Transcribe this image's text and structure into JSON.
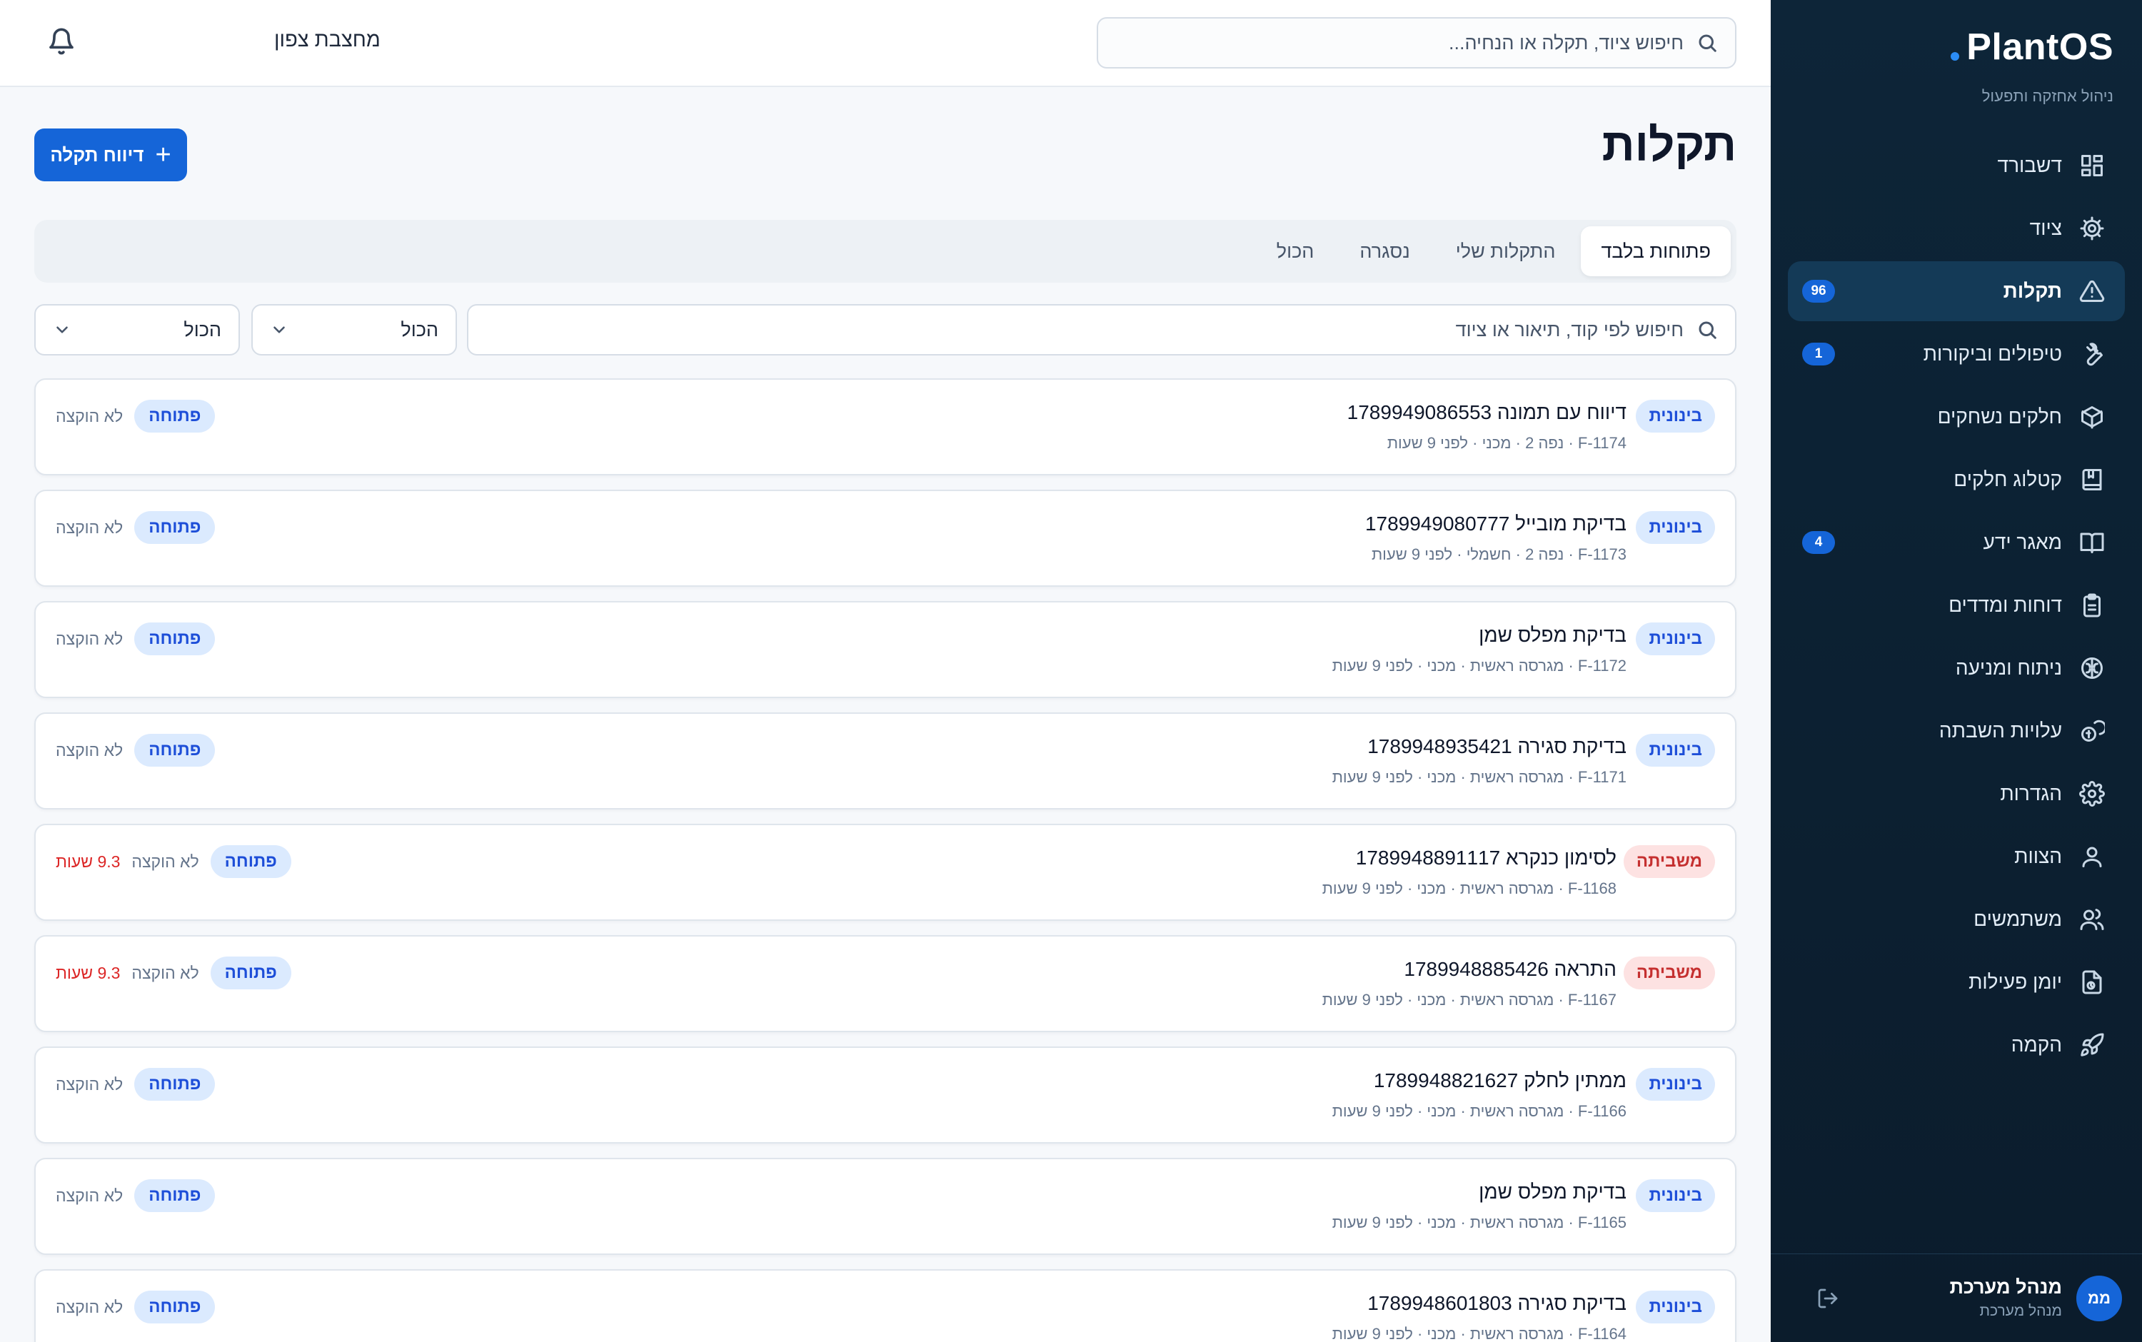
{
  "brand": {
    "title": "PlantOS",
    "subtitle": "ניהול אחזקה ותפעול"
  },
  "nav": [
    {
      "label": "דשבורד",
      "icon": "dashboard-icon",
      "badge": ""
    },
    {
      "label": "ציוד",
      "icon": "gear-icon",
      "badge": ""
    },
    {
      "label": "תקלות",
      "icon": "warning-icon",
      "badge": "96"
    },
    {
      "label": "טיפולים וביקורות",
      "icon": "wrench-icon",
      "badge": "1"
    },
    {
      "label": "חלקים נשחקים",
      "icon": "box-icon",
      "badge": ""
    },
    {
      "label": "קטלוג חלקים",
      "icon": "catalog-icon",
      "badge": ""
    },
    {
      "label": "מאגר ידע",
      "icon": "book-icon",
      "badge": "4"
    },
    {
      "label": "דוחות ומדדים",
      "icon": "clipboard-icon",
      "badge": ""
    },
    {
      "label": "ניתוח ומניעה",
      "icon": "brain-icon",
      "badge": ""
    },
    {
      "label": "עלויות השבתה",
      "icon": "coins-icon",
      "badge": ""
    },
    {
      "label": "הגדרות",
      "icon": "settings-icon",
      "badge": ""
    },
    {
      "label": "הצוות",
      "icon": "user-icon",
      "badge": ""
    },
    {
      "label": "משתמשים",
      "icon": "users-icon",
      "badge": ""
    },
    {
      "label": "יומן פעילות",
      "icon": "log-icon",
      "badge": ""
    },
    {
      "label": "הקמה",
      "icon": "rocket-icon",
      "badge": ""
    }
  ],
  "user": {
    "initials": "ממ",
    "name": "מנהל מערכת",
    "role": "מנהל מערכת"
  },
  "topbar": {
    "search_placeholder": "חיפוש ציוד, תקלה או הנחיה...",
    "site": "מחצבת צפון"
  },
  "page": {
    "title": "תקלות",
    "report_button": "דיווח תקלה"
  },
  "tabs": [
    "פתוחות בלבד",
    "התקלות שלי",
    "נסגרה",
    "הכול"
  ],
  "filters": {
    "search_placeholder": "חיפוש לפי קוד, תיאור או ציוד",
    "select1": "הכול",
    "select2": "הכול"
  },
  "faults": [
    {
      "severity": "בינונית",
      "severity_kind": "medium",
      "title": "דיווח עם תמונה 1789949086553",
      "meta": "F-1174 · נפה 2 · מכני · לפני 9 שעות",
      "hours": "",
      "assignee": "לא הוקצה",
      "status": "פתוחה"
    },
    {
      "severity": "בינונית",
      "severity_kind": "medium",
      "title": "בדיקת מובייל 1789949080777",
      "meta": "F-1173 · נפה 2 · חשמלי · לפני 9 שעות",
      "hours": "",
      "assignee": "לא הוקצה",
      "status": "פתוחה"
    },
    {
      "severity": "בינונית",
      "severity_kind": "medium",
      "title": "בדיקת מפלס שמן",
      "meta": "F-1172 · מגרסה ראשית · מכני · לפני 9 שעות",
      "hours": "",
      "assignee": "לא הוקצה",
      "status": "פתוחה"
    },
    {
      "severity": "בינונית",
      "severity_kind": "medium",
      "title": "בדיקת סגירה 1789948935421",
      "meta": "F-1171 · מגרסה ראשית · מכני · לפני 9 שעות",
      "hours": "",
      "assignee": "לא הוקצה",
      "status": "פתוחה"
    },
    {
      "severity": "משביתה",
      "severity_kind": "down",
      "title": "לסימון כנקרא 1789948891117",
      "meta": "F-1168 · מגרסה ראשית · מכני · לפני 9 שעות",
      "hours": "9.3 שעות",
      "assignee": "לא הוקצה",
      "status": "פתוחה"
    },
    {
      "severity": "משביתה",
      "severity_kind": "down",
      "title": "התראה 1789948885426",
      "meta": "F-1167 · מגרסה ראשית · מכני · לפני 9 שעות",
      "hours": "9.3 שעות",
      "assignee": "לא הוקצה",
      "status": "פתוחה"
    },
    {
      "severity": "בינונית",
      "severity_kind": "medium",
      "title": "ממתין לחלק 1789948821627",
      "meta": "F-1166 · מגרסה ראשית · מכני · לפני 9 שעות",
      "hours": "",
      "assignee": "לא הוקצה",
      "status": "פתוחה"
    },
    {
      "severity": "בינונית",
      "severity_kind": "medium",
      "title": "בדיקת מפלס שמן",
      "meta": "F-1165 · מגרסה ראשית · מכני · לפני 9 שעות",
      "hours": "",
      "assignee": "לא הוקצה",
      "status": "פתוחה"
    },
    {
      "severity": "בינונית",
      "severity_kind": "medium",
      "title": "בדיקת סגירה 1789948601803",
      "meta": "F-1164 · מגרסה ראשית · מכני · לפני 9 שעות",
      "hours": "",
      "assignee": "לא הוקצה",
      "status": "פתוחה"
    }
  ]
}
